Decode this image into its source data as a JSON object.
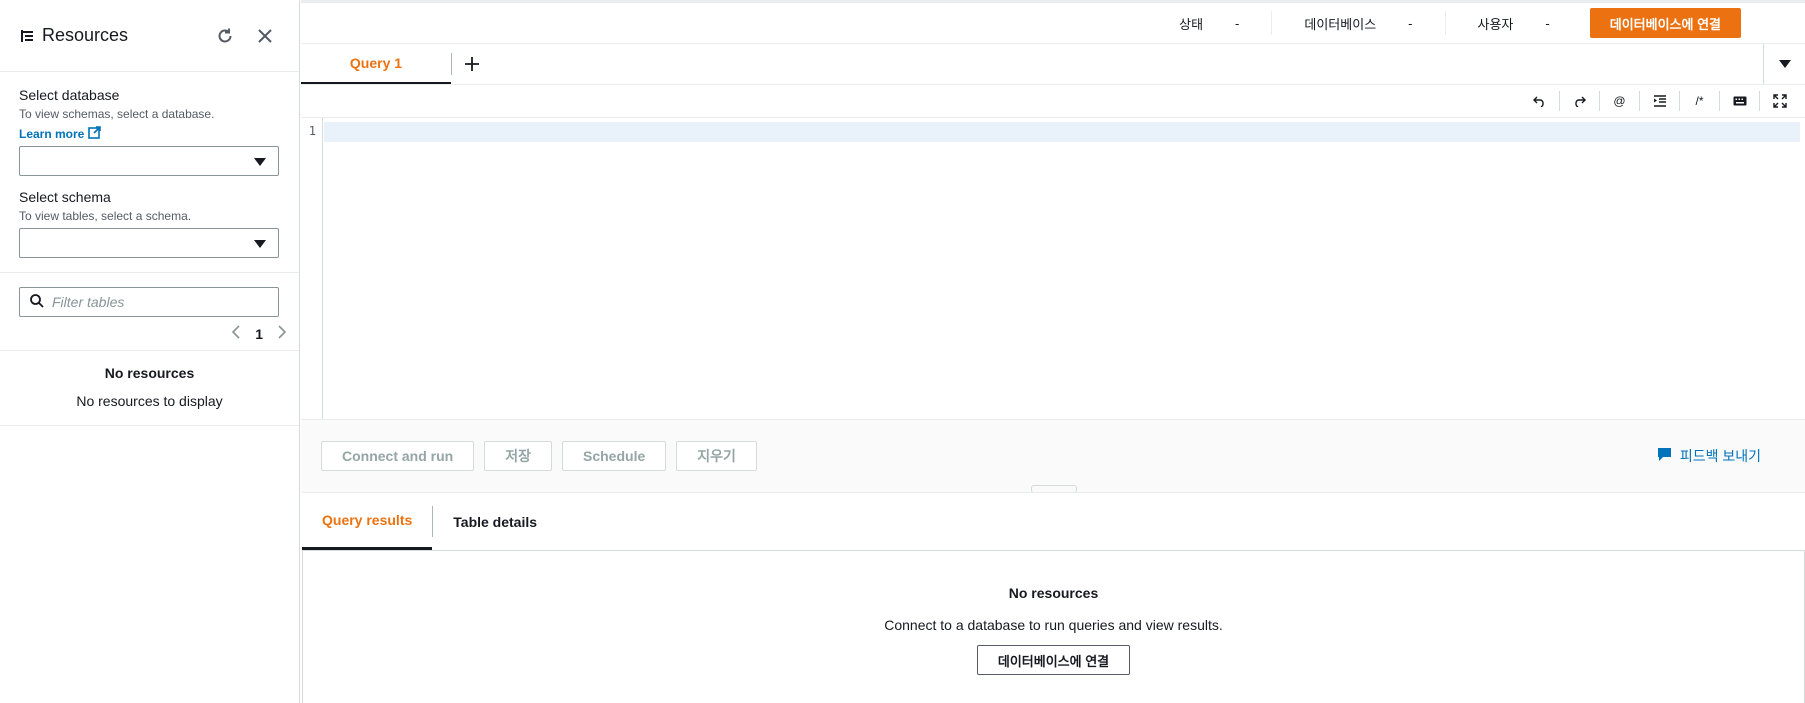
{
  "sidebar": {
    "title": "Resources",
    "select_database": {
      "label": "Select database",
      "description": "To view schemas, select a database.",
      "learn_more": "Learn more",
      "value": ""
    },
    "select_schema": {
      "label": "Select schema",
      "description": "To view tables, select a schema.",
      "value": ""
    },
    "filter": {
      "placeholder": "Filter tables",
      "value": ""
    },
    "pagination": {
      "current_page": "1"
    },
    "empty": {
      "title": "No resources",
      "message": "No resources to display"
    }
  },
  "status_bar": {
    "items": [
      {
        "label": "상태",
        "value": "-"
      },
      {
        "label": "데이터베이스",
        "value": "-"
      },
      {
        "label": "사용자",
        "value": "-"
      }
    ],
    "connect_button": "데이터베이스에 연결"
  },
  "editor_tabs": {
    "tabs": [
      {
        "label": "Query 1"
      }
    ]
  },
  "editor": {
    "line_numbers": [
      "1"
    ]
  },
  "actions": {
    "connect_and_run": "Connect and run",
    "save": "저장",
    "schedule": "Schedule",
    "clear": "지우기",
    "feedback": "피드백 보내기"
  },
  "results": {
    "tabs": [
      {
        "label": "Query results"
      },
      {
        "label": "Table details"
      }
    ],
    "empty_title": "No resources",
    "empty_message": "Connect to a database to run queries and view results.",
    "connect_button": "데이터베이스에 연결"
  },
  "colors": {
    "accent": "#ec7211",
    "link": "#0073bb",
    "text": "#16191f"
  }
}
